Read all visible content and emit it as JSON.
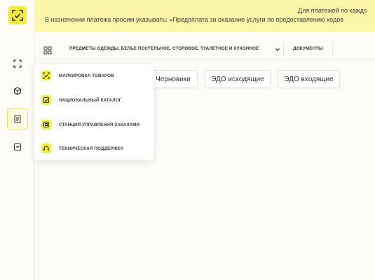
{
  "banner": {
    "line1": "Для платежей по каждо",
    "line2": "В назначении платежа просим указывать: «Предоплата за оказание услуги по предоставлению кодов"
  },
  "rail": {
    "items": [
      {
        "name": "scan-icon"
      },
      {
        "name": "box-icon"
      },
      {
        "name": "document-icon",
        "active": true
      },
      {
        "name": "chart-check-icon"
      }
    ]
  },
  "topnav": {
    "category": "ПРЕДМЕТЫ ОДЕЖДЫ, БЕЛЬЕ ПОСТЕЛЬНОЕ, СТОЛОВОЕ, ТУАЛЕТНОЕ И КУХОННОЕ",
    "documents": "ДОКУМЕНТЫ"
  },
  "buttons": {
    "drafts": "Черновики",
    "edo_out": "ЭДО исходящие",
    "edo_in": "ЭДО входящие"
  },
  "dropdown": {
    "items": [
      {
        "label": "МАРКИРОВКА ТОВАРОВ",
        "icon": "marking-icon"
      },
      {
        "label": "НАЦИОНАЛЬНЫЙ КАТАЛОГ",
        "icon": "catalog-icon"
      },
      {
        "label": "СТАНЦИЯ УПРАВЛЕНИЯ ЗАКАЗАМИ",
        "icon": "order-station-icon"
      },
      {
        "label": "ТЕХНИЧЕСКАЯ ПОДДЕРЖКА",
        "icon": "support-icon"
      }
    ]
  },
  "colors": {
    "accent": "#f2ee3b",
    "banner": "#fbf6a9",
    "background": "#fdfcf6"
  }
}
